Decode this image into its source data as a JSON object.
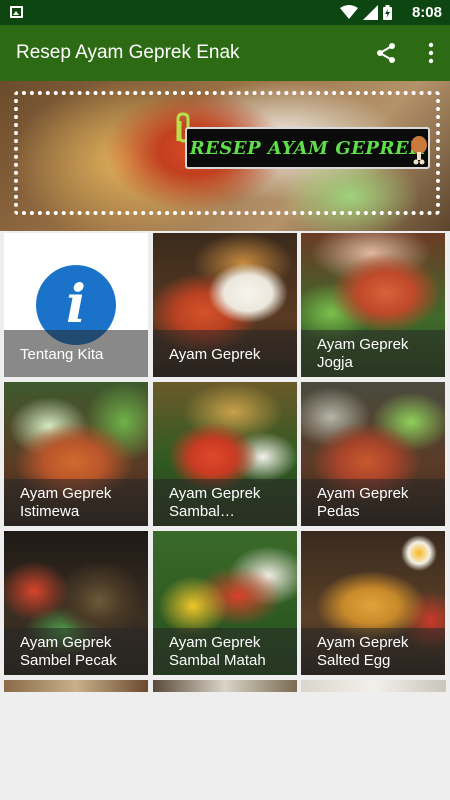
{
  "statusbar": {
    "time": "8:08",
    "icons": [
      "image-icon",
      "wifi-icon",
      "signal-icon",
      "battery-charging-icon"
    ]
  },
  "appbar": {
    "title": "Resep Ayam Geprek Enak",
    "actions": [
      "share-icon",
      "more-vert-icon"
    ]
  },
  "banner": {
    "logo_text": "RESEP AYAM GEPREK"
  },
  "tiles": [
    {
      "id": "tentang-kita",
      "lines": [
        "Tentang Kita"
      ],
      "icon": "info-icon"
    },
    {
      "id": "ayam-geprek",
      "lines": [
        "Ayam Geprek"
      ]
    },
    {
      "id": "ayam-geprek-jogja",
      "lines": [
        "Ayam Geprek",
        "Jogja"
      ]
    },
    {
      "id": "ayam-geprek-istimewa",
      "lines": [
        "Ayam Geprek",
        "Istimewa"
      ]
    },
    {
      "id": "ayam-geprek-sambal",
      "lines": [
        "Ayam Geprek",
        "Sambal…"
      ]
    },
    {
      "id": "ayam-geprek-pedas",
      "lines": [
        "Ayam Geprek",
        "Pedas"
      ]
    },
    {
      "id": "ayam-geprek-sambel-pecak",
      "lines": [
        "Ayam Geprek",
        "Sambel Pecak"
      ]
    },
    {
      "id": "ayam-geprek-sambal-matah",
      "lines": [
        "Ayam Geprek",
        "Sambal Matah"
      ]
    },
    {
      "id": "ayam-geprek-salted-egg",
      "lines": [
        "Ayam Geprek",
        "Salted Egg"
      ]
    }
  ],
  "colors": {
    "status_bar": "#0d4610",
    "app_bar": "#2d6a14",
    "logo_text": "#5fe04a",
    "info_circle": "#1a73c8",
    "background": "#eeeeee"
  }
}
